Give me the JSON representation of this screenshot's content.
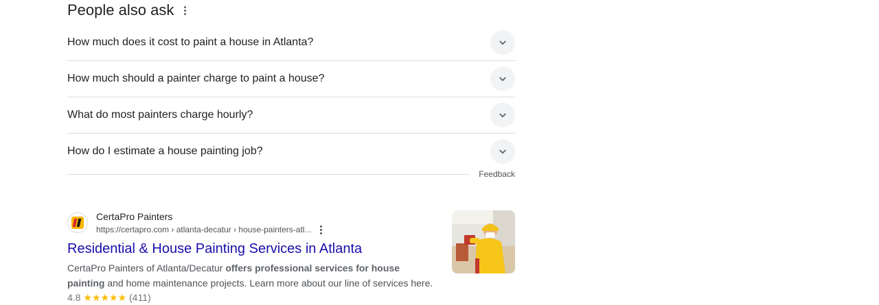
{
  "paa": {
    "title": "People also ask",
    "questions": [
      {
        "text": "How much does it cost to paint a house in Atlanta?"
      },
      {
        "text": "How much should a painter charge to paint a house?"
      },
      {
        "text": "What do most painters charge hourly?"
      },
      {
        "text": "How do I estimate a house painting job?"
      }
    ],
    "feedback": "Feedback"
  },
  "result": {
    "site_name": "CertaPro Painters",
    "url": "https://certapro.com › atlanta-decatur › house-painters-atl...",
    "title": "Residential & House Painting Services in Atlanta",
    "snippet_1": "CertaPro Painters of Atlanta/Decatur ",
    "snippet_bold": "offers professional services for house painting",
    "snippet_2": " and home maintenance projects. Learn more about our line of services here.",
    "rating": "4.8",
    "stars": "★★★★★",
    "reviews": "(411)"
  },
  "colors": {
    "link": "#1a0dab",
    "text": "#202124",
    "muted": "#4d5156",
    "star": "#fbbc04",
    "divider": "#dadce0"
  }
}
